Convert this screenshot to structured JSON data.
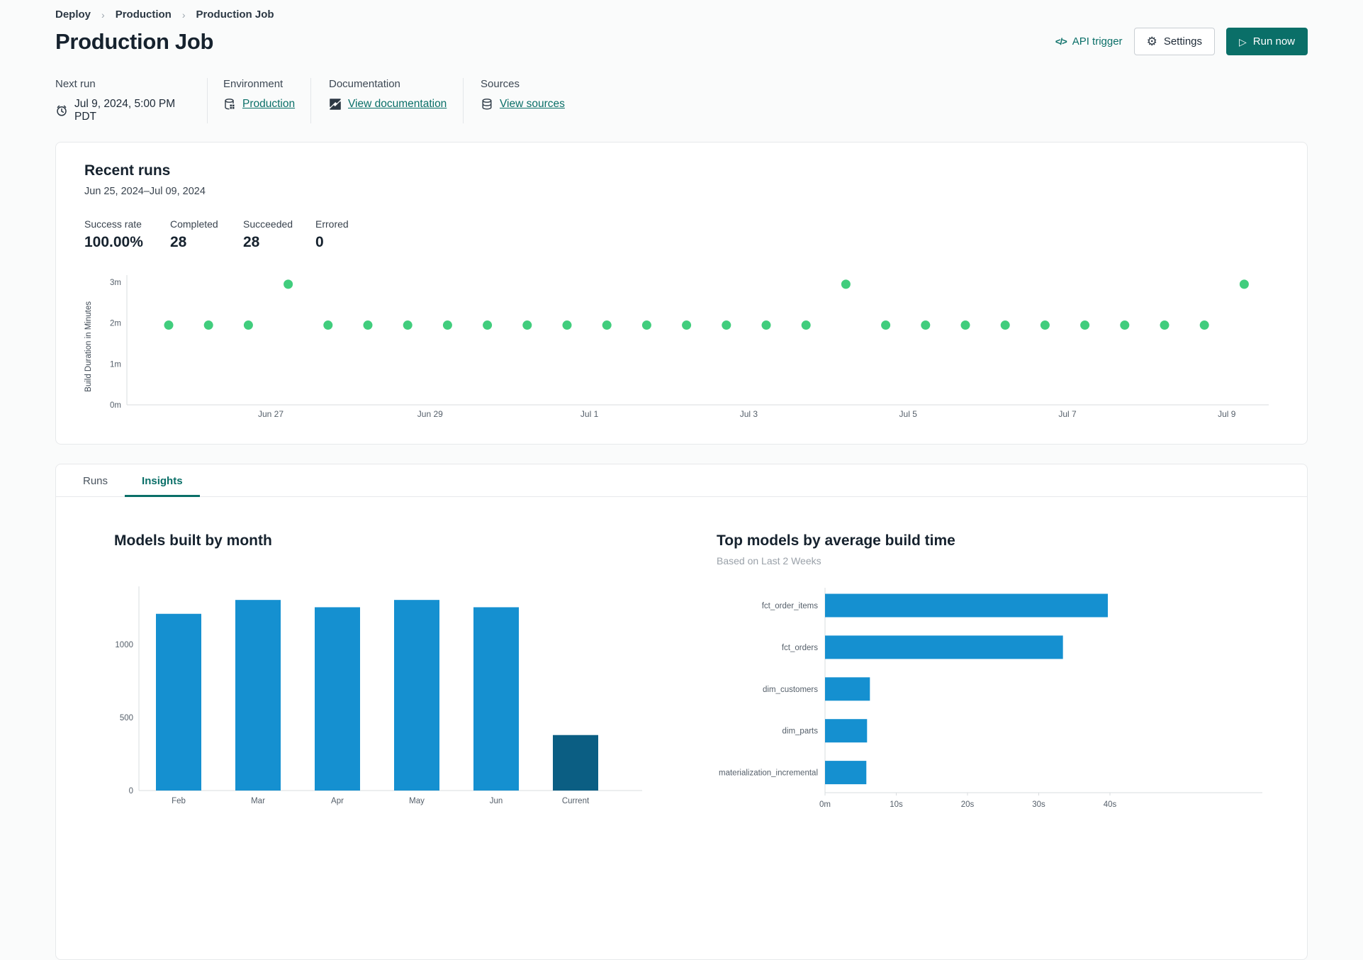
{
  "breadcrumb": {
    "items": [
      "Deploy",
      "Production",
      "Production Job"
    ],
    "separator": "›"
  },
  "icons": {
    "code": "</>",
    "gear": "⚙",
    "play": "▷",
    "chevron": "›"
  },
  "header": {
    "title": "Production Job",
    "api_trigger_label": "API trigger",
    "settings_label": "Settings",
    "run_now_label": "Run now"
  },
  "info": {
    "columns": [
      {
        "label": "Next run",
        "value": "Jul 9, 2024, 5:00 PM PDT",
        "icon": "alarm-clock"
      },
      {
        "label": "Environment",
        "value": "Production",
        "icon": "environment-database"
      },
      {
        "label": "Documentation",
        "value": "View documentation",
        "icon": "dbt-logo"
      },
      {
        "label": "Sources",
        "value": "View sources",
        "icon": "sources-database"
      }
    ]
  },
  "recent_runs": {
    "title": "Recent runs",
    "date_range": "Jun 25, 2024–Jul 09, 2024",
    "stats": [
      {
        "label": "Success rate",
        "value": "100.00%"
      },
      {
        "label": "Completed",
        "value": "28"
      },
      {
        "label": "Succeeded",
        "value": "28"
      },
      {
        "label": "Errored",
        "value": "0"
      }
    ]
  },
  "tabs": [
    {
      "label": "Runs",
      "active": false
    },
    {
      "label": "Insights",
      "active": true
    }
  ],
  "colors": {
    "accent_teal": "#0a6f68",
    "dot_green": "#41cd7d",
    "bar_blue": "#1590d0",
    "bar_dark_blue": "#0b5e83",
    "axis_gray": "#d9dcdf",
    "tick_text": "#555f6a"
  },
  "chart_data": [
    {
      "id": "build-duration-scatter",
      "type": "scatter",
      "ylabel": "Build Duration in Minutes",
      "y_ticks": [
        "0m",
        "1m",
        "2m",
        "3m"
      ],
      "ylim": [
        0,
        3.2
      ],
      "x_tick_labels": [
        "Jun 27",
        "Jun 29",
        "Jul 1",
        "Jul 3",
        "Jul 5",
        "Jul 7",
        "Jul 9"
      ],
      "point_color": "#41cd7d",
      "runs_per_day": 2,
      "durations_minutes": [
        1.95,
        1.95,
        1.95,
        2.95,
        1.95,
        1.95,
        1.95,
        1.95,
        1.95,
        1.95,
        1.95,
        1.95,
        1.95,
        1.95,
        1.95,
        1.95,
        1.95,
        2.95,
        1.95,
        1.95,
        1.95,
        1.95,
        1.95,
        1.95,
        1.95,
        1.95,
        1.95,
        2.95
      ]
    },
    {
      "id": "models-built-by-month",
      "type": "bar",
      "title": "Models built by month",
      "categories": [
        "Feb",
        "Mar",
        "Apr",
        "May",
        "Jun",
        "Current"
      ],
      "values": [
        1210,
        1305,
        1255,
        1305,
        1255,
        380
      ],
      "bar_colors": [
        "#1590d0",
        "#1590d0",
        "#1590d0",
        "#1590d0",
        "#1590d0",
        "#0b5e83"
      ],
      "y_ticks": [
        0,
        500,
        1000
      ],
      "ylim": [
        0,
        1400
      ],
      "xlabel": "",
      "ylabel": ""
    },
    {
      "id": "top-models-by-avg-build-time",
      "type": "bar-horizontal",
      "title": "Top models by average build time",
      "subtitle": "Based on Last 2 Weeks",
      "categories": [
        "fct_order_items",
        "fct_orders",
        "dim_customers",
        "dim_parts",
        "materialization_incremental"
      ],
      "values_seconds": [
        39.7,
        33.4,
        6.3,
        5.9,
        5.8
      ],
      "bar_color": "#1590d0",
      "x_ticks": [
        "0m",
        "10s",
        "20s",
        "30s",
        "40s"
      ],
      "xlim": [
        0,
        44
      ]
    }
  ]
}
